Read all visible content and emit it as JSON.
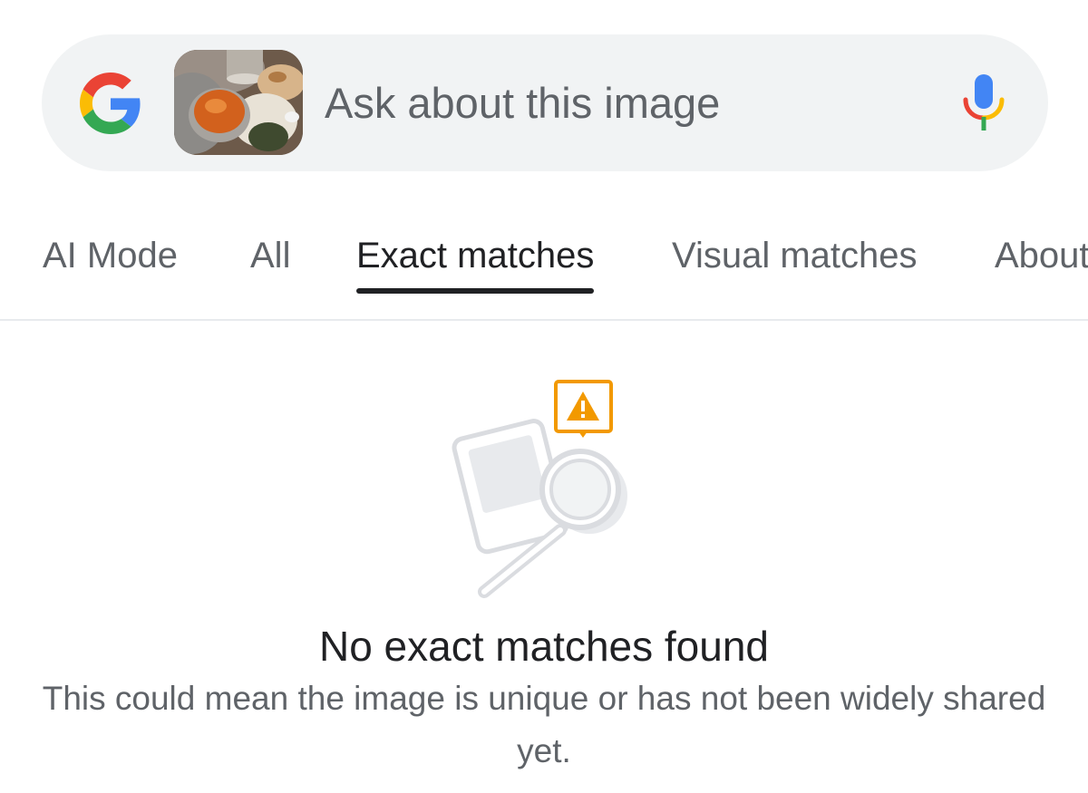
{
  "search": {
    "placeholder": "Ask about this image",
    "query_image": "food-thali-thumbnail",
    "logo_icon": "google-g-icon",
    "voice_icon": "microphone-icon"
  },
  "tabs": [
    {
      "label": "AI Mode",
      "active": false
    },
    {
      "label": "All",
      "active": false
    },
    {
      "label": "Exact matches",
      "active": true
    },
    {
      "label": "Visual matches",
      "active": false
    },
    {
      "label": "About",
      "active": false
    }
  ],
  "empty_state": {
    "illustration_icon": "image-magnifier-warning-icon",
    "title": "No exact matches found",
    "description": "This could mean the image is unique or has not been widely shared yet."
  },
  "colors": {
    "google_blue": "#4285F4",
    "google_red": "#EA4335",
    "google_yellow": "#FBBC05",
    "google_green": "#34A853",
    "warning_orange": "#F29900",
    "active_tab": "#202124"
  }
}
